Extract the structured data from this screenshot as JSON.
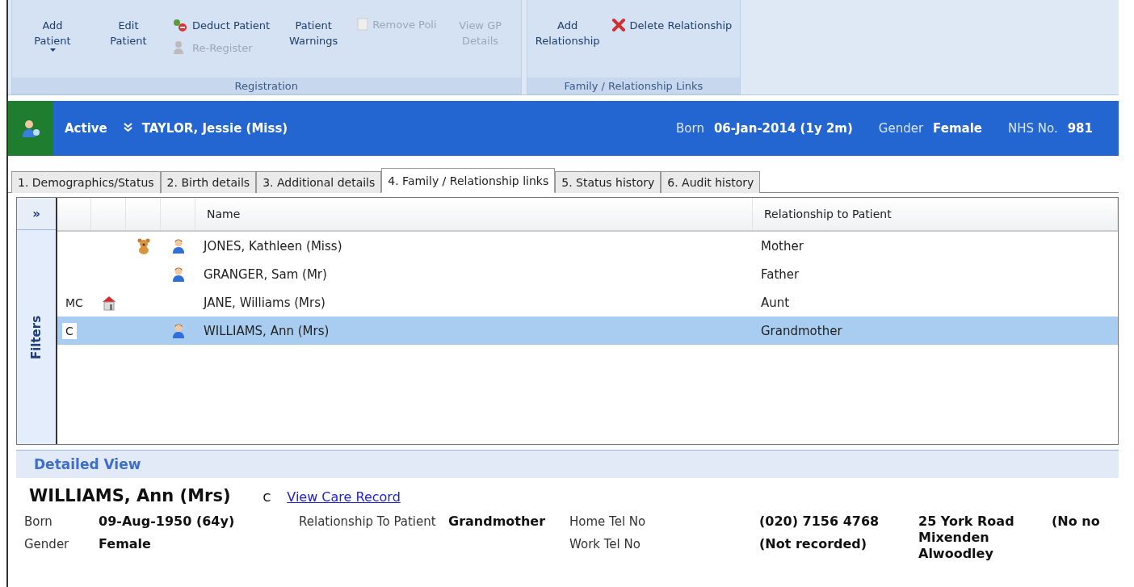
{
  "ribbon": {
    "groups": [
      {
        "label": "Registration",
        "buttons": [
          {
            "kind": "large",
            "label": "Add Patient",
            "dropdown": true,
            "disabled": false
          },
          {
            "kind": "large",
            "label": "Edit Patient",
            "dropdown": false,
            "disabled": false
          },
          {
            "kind": "stack",
            "items": [
              {
                "label": "Deduct Patient",
                "kind": "deduct",
                "disabled": false
              },
              {
                "label": "Re-Register",
                "kind": "people",
                "disabled": true
              }
            ]
          },
          {
            "kind": "large",
            "label": "Patient Warnings",
            "dropdown": false,
            "disabled": false
          },
          {
            "kind": "stack",
            "items": [
              {
                "label": "Remove Poli",
                "kind": "doc",
                "disabled": true
              }
            ]
          },
          {
            "kind": "large",
            "label": "View GP Details",
            "dropdown": false,
            "disabled": true
          }
        ]
      },
      {
        "label": "Family / Relationship Links",
        "buttons": [
          {
            "kind": "large",
            "label": "Add Relationship",
            "dropdown": false,
            "disabled": false
          },
          {
            "kind": "stack",
            "items": [
              {
                "label": "Delete Relationship",
                "kind": "delete",
                "disabled": false
              }
            ]
          }
        ]
      }
    ]
  },
  "banner": {
    "status": "Active",
    "name": "TAYLOR, Jessie (Miss)",
    "born_label": "Born",
    "born": "06-Jan-2014 (1y 2m)",
    "gender_label": "Gender",
    "gender": "Female",
    "nhs_label": "NHS No.",
    "nhs": "981"
  },
  "tabs": [
    {
      "label": "1. Demographics/Status",
      "selected": false
    },
    {
      "label": "2. Birth details",
      "selected": false
    },
    {
      "label": "3. Additional details",
      "selected": false
    },
    {
      "label": "4. Family / Relationship links",
      "selected": true
    },
    {
      "label": "5. Status history",
      "selected": false
    },
    {
      "label": "6. Audit history",
      "selected": false
    }
  ],
  "filters": {
    "toggle": "»",
    "label": "Filters"
  },
  "grid": {
    "columns": [
      "Name",
      "Relationship to Patient"
    ],
    "rows": [
      {
        "code": "",
        "home": false,
        "child": true,
        "person": true,
        "name": "JONES, Kathleen (Miss)",
        "relationship": "Mother",
        "selected": false
      },
      {
        "code": "",
        "home": false,
        "child": false,
        "person": true,
        "name": "GRANGER, Sam (Mr)",
        "relationship": "Father",
        "selected": false
      },
      {
        "code": "MC",
        "home": true,
        "child": false,
        "person": false,
        "name": "JANE, Williams (Mrs)",
        "relationship": "Aunt",
        "selected": false
      },
      {
        "code": "C",
        "home": false,
        "child": false,
        "person": true,
        "name": "WILLIAMS, Ann (Mrs)",
        "relationship": "Grandmother",
        "selected": true
      }
    ]
  },
  "detail": {
    "title": "Detailed View",
    "name": "WILLIAMS, Ann (Mrs)",
    "code": "C",
    "link": "View Care Record",
    "columns": [
      [
        {
          "label": "Born",
          "value": "09-Aug-1950 (64y)"
        },
        {
          "label": "Gender",
          "value": "Female"
        }
      ],
      [
        {
          "label": "Relationship To Patient",
          "value": "Grandmother"
        }
      ],
      [
        {
          "label": "Home Tel No",
          "value": "(020) 7156 4768"
        },
        {
          "label": "Work Tel No",
          "value": "(Not recorded)"
        }
      ]
    ],
    "address": [
      "25 York Road",
      "Mixenden",
      "Alwoodley"
    ],
    "column_extra": "(No no"
  }
}
